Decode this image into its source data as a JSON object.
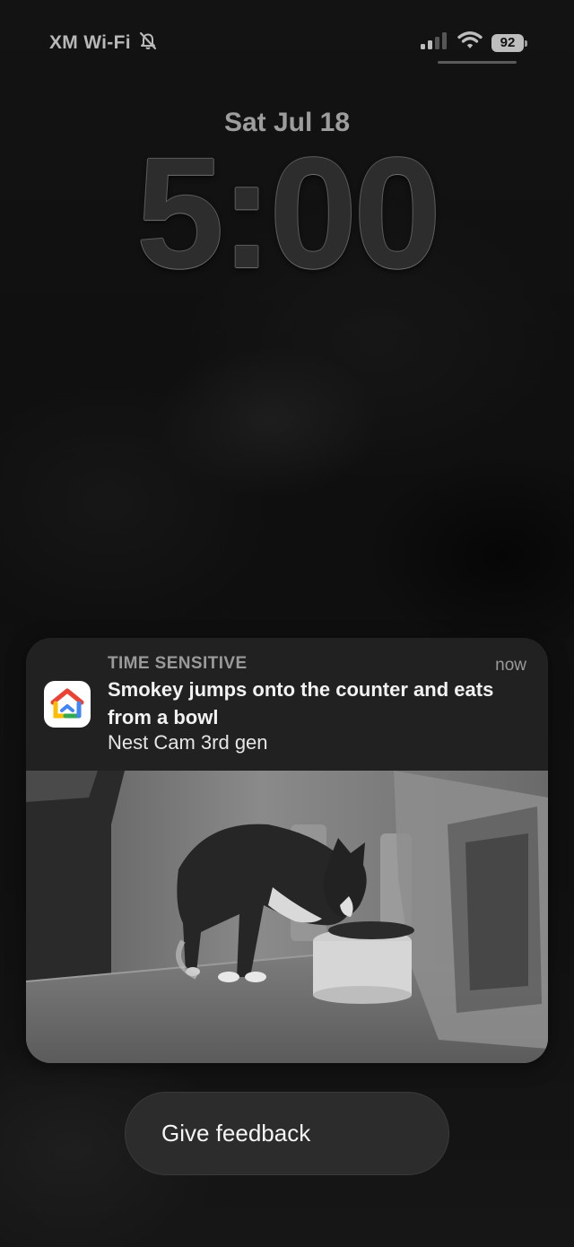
{
  "status_bar": {
    "carrier": "XM Wi-Fi",
    "battery_level": "92",
    "icons": [
      "bell-slash-icon",
      "cellular-signal-icon",
      "wifi-icon",
      "battery-icon"
    ]
  },
  "lock_screen": {
    "date": "Sat Jul 18",
    "time": "5:00"
  },
  "notification": {
    "app_icon": "google-home-icon",
    "category": "TIME SENSITIVE",
    "timestamp": "now",
    "title": "Smokey jumps onto the counter and eats from a bowl",
    "subtitle": "Nest Cam 3rd gen",
    "media": "camera-snapshot"
  },
  "feedback_button": {
    "label": "Give feedback"
  },
  "colors": {
    "card_background": "#212121",
    "home_red": "#ea4335",
    "home_yellow": "#fbbc04",
    "home_green": "#34a853",
    "home_blue": "#4285f4"
  }
}
